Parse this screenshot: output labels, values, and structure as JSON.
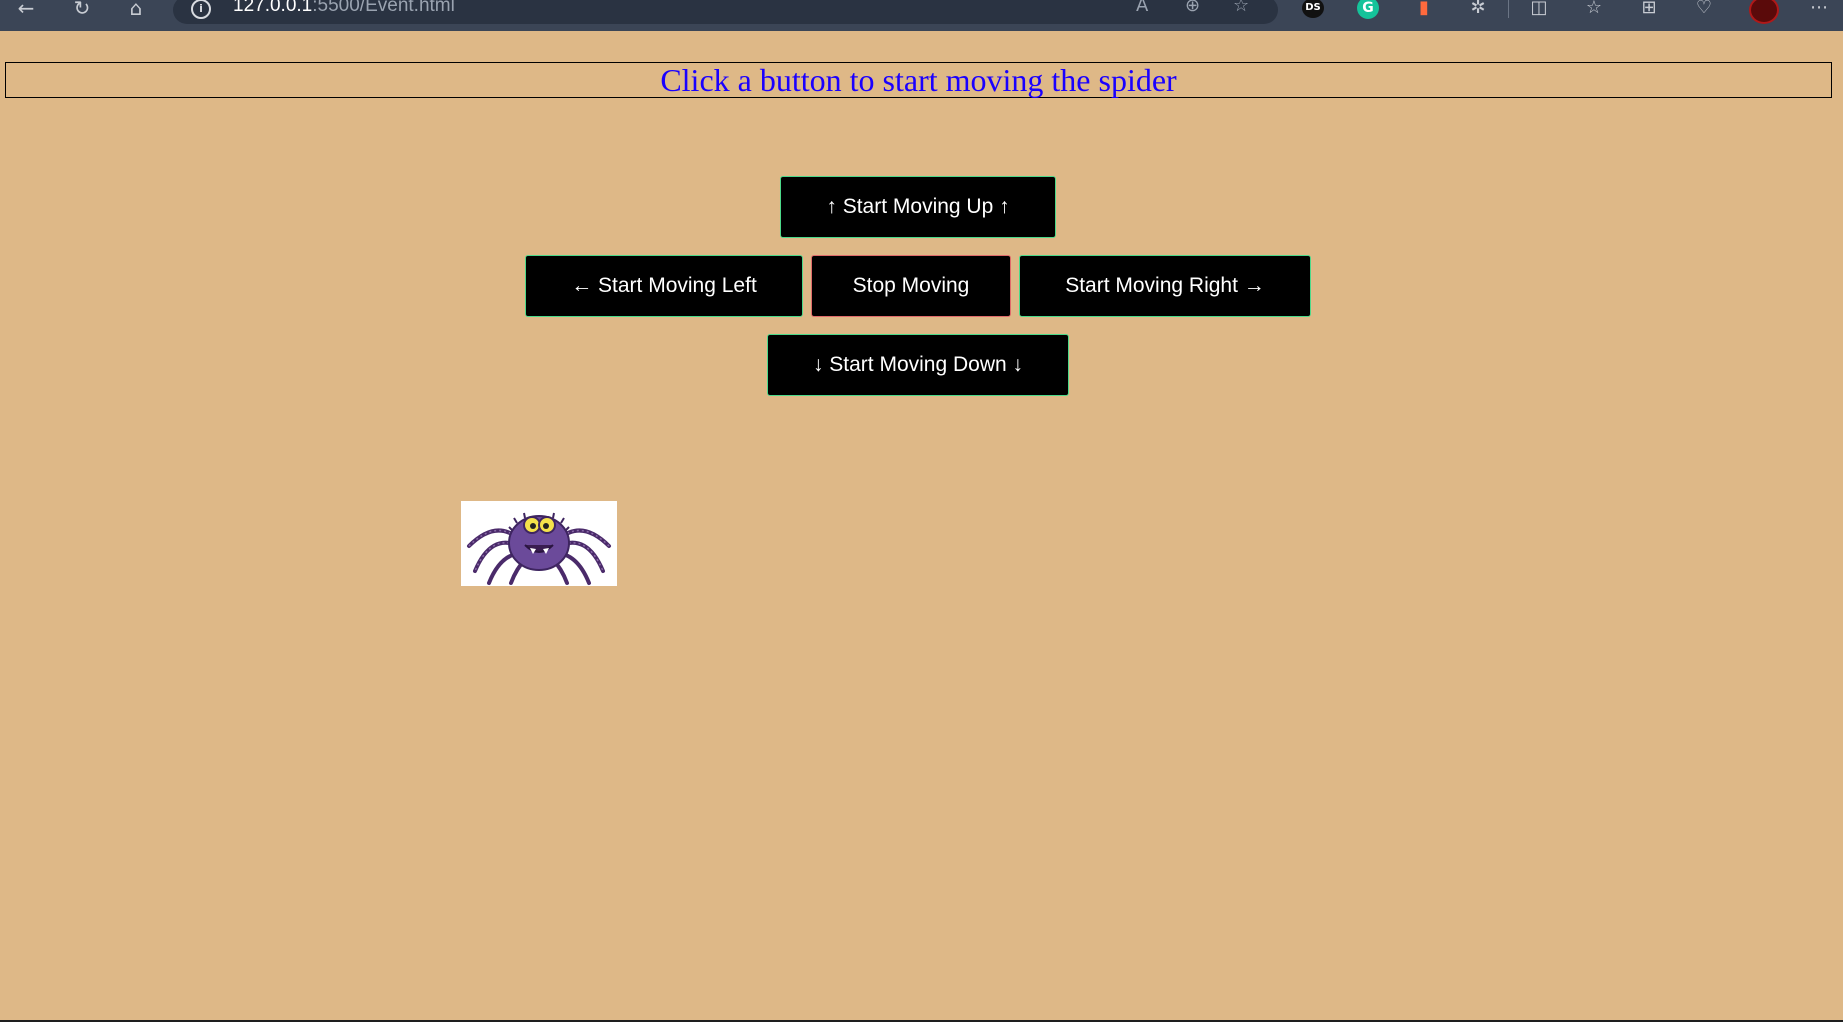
{
  "browser": {
    "url_host": "127.0.0.1",
    "url_rest": ":5500/Event.html",
    "ext_ds_label": "DS",
    "ext_g_label": "G"
  },
  "page": {
    "heading": "Click a button to start moving the spider",
    "buttons": {
      "up": "↑ Start Moving Up ↑",
      "left": "← Start Moving Left",
      "stop": "Stop Moving",
      "right": "Start Moving Right →",
      "down": "↓ Start Moving Down ↓"
    },
    "spider_icon": "spider-image"
  },
  "colors": {
    "background": "#deb887",
    "heading_text": "#1a00ff",
    "button_bg": "#000000",
    "button_text": "#ffffff"
  }
}
